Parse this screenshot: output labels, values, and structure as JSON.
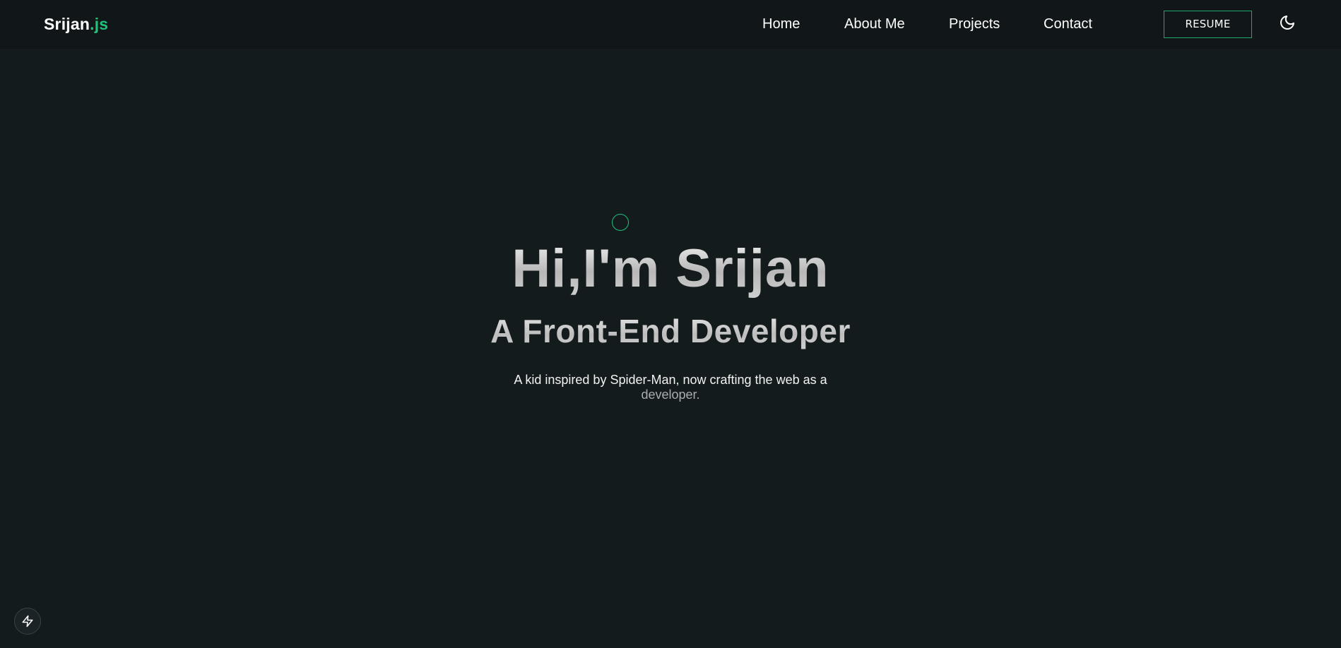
{
  "header": {
    "brand_name": "Srijan",
    "brand_suffix": ".js",
    "nav": {
      "home": "Home",
      "about": "About Me",
      "projects": "Projects",
      "contact": "Contact"
    },
    "resume_label": "RESUME",
    "theme_icon": "moon-icon"
  },
  "hero": {
    "title": "Hi,I'm Srijan",
    "subtitle": "A Front-End Developer",
    "description_main": "A kid inspired by Spider-Man, now crafting the web as a",
    "description_tail": "developer."
  },
  "widgets": {
    "quick_action_icon": "lightning-icon"
  },
  "colors": {
    "background": "#141b1d",
    "header": "#111719",
    "accent": "#1fc37a",
    "text": "#ffffff"
  }
}
